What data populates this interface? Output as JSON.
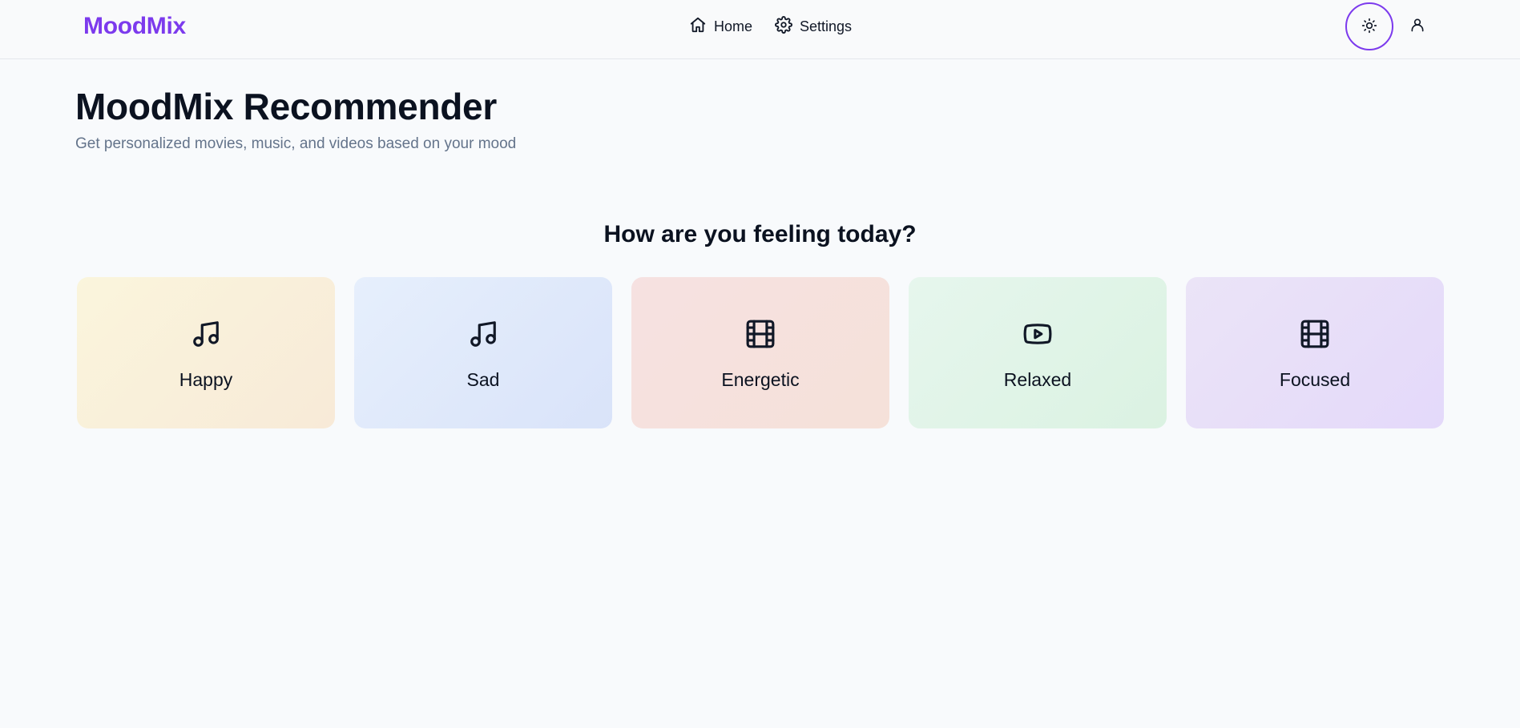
{
  "header": {
    "logo": "MoodMix",
    "nav": [
      {
        "label": "Home",
        "icon": "home-icon"
      },
      {
        "label": "Settings",
        "icon": "gear-icon"
      }
    ],
    "theme_toggle_icon": "sun-icon",
    "user_icon": "user-icon",
    "accent_color": "#7c3aed"
  },
  "main": {
    "title": "MoodMix Recommender",
    "subtitle": "Get personalized movies, music, and videos based on your mood",
    "question": "How are you feeling today?",
    "moods": [
      {
        "label": "Happy",
        "icon": "music-note-icon",
        "color": "#faf0dc"
      },
      {
        "label": "Sad",
        "icon": "music-note-icon",
        "color": "#dfe8fa"
      },
      {
        "label": "Energetic",
        "icon": "film-icon",
        "color": "#f5e1dd"
      },
      {
        "label": "Relaxed",
        "icon": "youtube-play-icon",
        "color": "#e0f4e7"
      },
      {
        "label": "Focused",
        "icon": "film-icon",
        "color": "#e8def9"
      }
    ]
  }
}
